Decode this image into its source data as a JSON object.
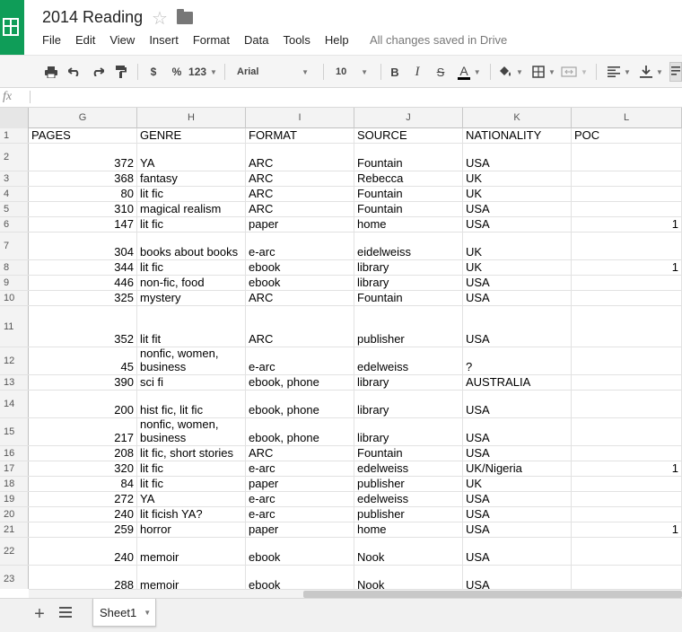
{
  "app": {
    "title": "2014 Reading",
    "save_status": "All changes saved in Drive",
    "brand_color": "#0f9d58"
  },
  "menu": [
    "File",
    "Edit",
    "View",
    "Insert",
    "Format",
    "Data",
    "Tools",
    "Help"
  ],
  "toolbar": {
    "currency": "$",
    "percent": "%",
    "number_format": "123",
    "font": "Arial",
    "font_size": "10",
    "bold": "B",
    "italic": "I",
    "strike": "S",
    "text_color": "A",
    "icons": [
      "print-icon",
      "undo-icon",
      "redo-icon",
      "paint-format-icon",
      "fill-color-icon",
      "borders-icon",
      "merge-icon",
      "align-left-icon",
      "valign-icon",
      "wrap-icon"
    ]
  },
  "formula_bar": {
    "icon": "fx",
    "value": ""
  },
  "columns": [
    "G",
    "H",
    "I",
    "J",
    "K",
    "L"
  ],
  "rows": [
    {
      "n": "1",
      "h": 17,
      "header": true,
      "cells": [
        "PAGES",
        "GENRE",
        "FORMAT",
        "SOURCE",
        "NATIONALITY",
        "POC"
      ]
    },
    {
      "n": "2",
      "h": 31,
      "cells": [
        "372",
        "YA",
        "ARC",
        "Fountain",
        "USA",
        ""
      ]
    },
    {
      "n": "3",
      "h": 17,
      "cells": [
        "368",
        "fantasy",
        "ARC",
        "Rebecca",
        "UK",
        ""
      ]
    },
    {
      "n": "4",
      "h": 17,
      "cells": [
        "80",
        "lit fic",
        "ARC",
        "Fountain",
        "UK",
        ""
      ]
    },
    {
      "n": "5",
      "h": 17,
      "cells": [
        "310",
        "magical realism",
        "ARC",
        "Fountain",
        "USA",
        ""
      ]
    },
    {
      "n": "6",
      "h": 17,
      "cells": [
        "147",
        "lit fic",
        "paper",
        "home",
        "USA",
        "1"
      ]
    },
    {
      "n": "7",
      "h": 31,
      "cells": [
        "304",
        "books about books",
        "e-arc",
        "eidelweiss",
        "UK",
        ""
      ]
    },
    {
      "n": "8",
      "h": 17,
      "cells": [
        "344",
        "lit fic",
        "ebook",
        "library",
        "UK",
        "1"
      ]
    },
    {
      "n": "9",
      "h": 17,
      "cells": [
        "446",
        "non-fic, food",
        "ebook",
        "library",
        "USA",
        ""
      ]
    },
    {
      "n": "10",
      "h": 17,
      "cells": [
        "325",
        "mystery",
        "ARC",
        "Fountain",
        "USA",
        ""
      ]
    },
    {
      "n": "11",
      "h": 46,
      "cells": [
        "352",
        "lit fit",
        "ARC",
        "publisher",
        "USA",
        ""
      ]
    },
    {
      "n": "12",
      "h": 31,
      "cells": [
        "45",
        "nonfic, women,\nbusiness",
        "e-arc",
        "edelweiss",
        "?",
        ""
      ]
    },
    {
      "n": "13",
      "h": 17,
      "cells": [
        "390",
        "sci fi",
        "ebook, phone",
        "library",
        "AUSTRALIA",
        ""
      ]
    },
    {
      "n": "14",
      "h": 31,
      "cells": [
        "200",
        "hist fic, lit fic",
        "ebook, phone",
        "library",
        "USA",
        ""
      ]
    },
    {
      "n": "15",
      "h": 31,
      "cells": [
        "217",
        "nonfic, women,\nbusiness",
        "ebook, phone",
        "library",
        "USA",
        ""
      ]
    },
    {
      "n": "16",
      "h": 17,
      "cells": [
        "208",
        "lit fic, short stories",
        "ARC",
        "Fountain",
        "USA",
        ""
      ]
    },
    {
      "n": "17",
      "h": 17,
      "cells": [
        "320",
        "lit fic",
        "e-arc",
        "edelweiss",
        "UK/Nigeria",
        "1"
      ]
    },
    {
      "n": "18",
      "h": 17,
      "cells": [
        "84",
        "lit fic",
        "paper",
        "publisher",
        "UK",
        ""
      ]
    },
    {
      "n": "19",
      "h": 17,
      "cells": [
        "272",
        "YA",
        "e-arc",
        "edelweiss",
        "USA",
        ""
      ]
    },
    {
      "n": "20",
      "h": 17,
      "cells": [
        "240",
        "lit ficish YA?",
        "e-arc",
        "publisher",
        "USA",
        ""
      ]
    },
    {
      "n": "21",
      "h": 17,
      "cells": [
        "259",
        "horror",
        "paper",
        "home",
        "USA",
        "1"
      ]
    },
    {
      "n": "22",
      "h": 31,
      "cells": [
        "240",
        "memoir",
        "ebook",
        "Nook",
        "USA",
        ""
      ]
    },
    {
      "n": "23",
      "h": 31,
      "cells": [
        "288",
        "memoir",
        "ebook",
        "Nook",
        "USA",
        ""
      ]
    }
  ],
  "sheets": [
    {
      "label": "Sheet1",
      "active": true
    }
  ]
}
